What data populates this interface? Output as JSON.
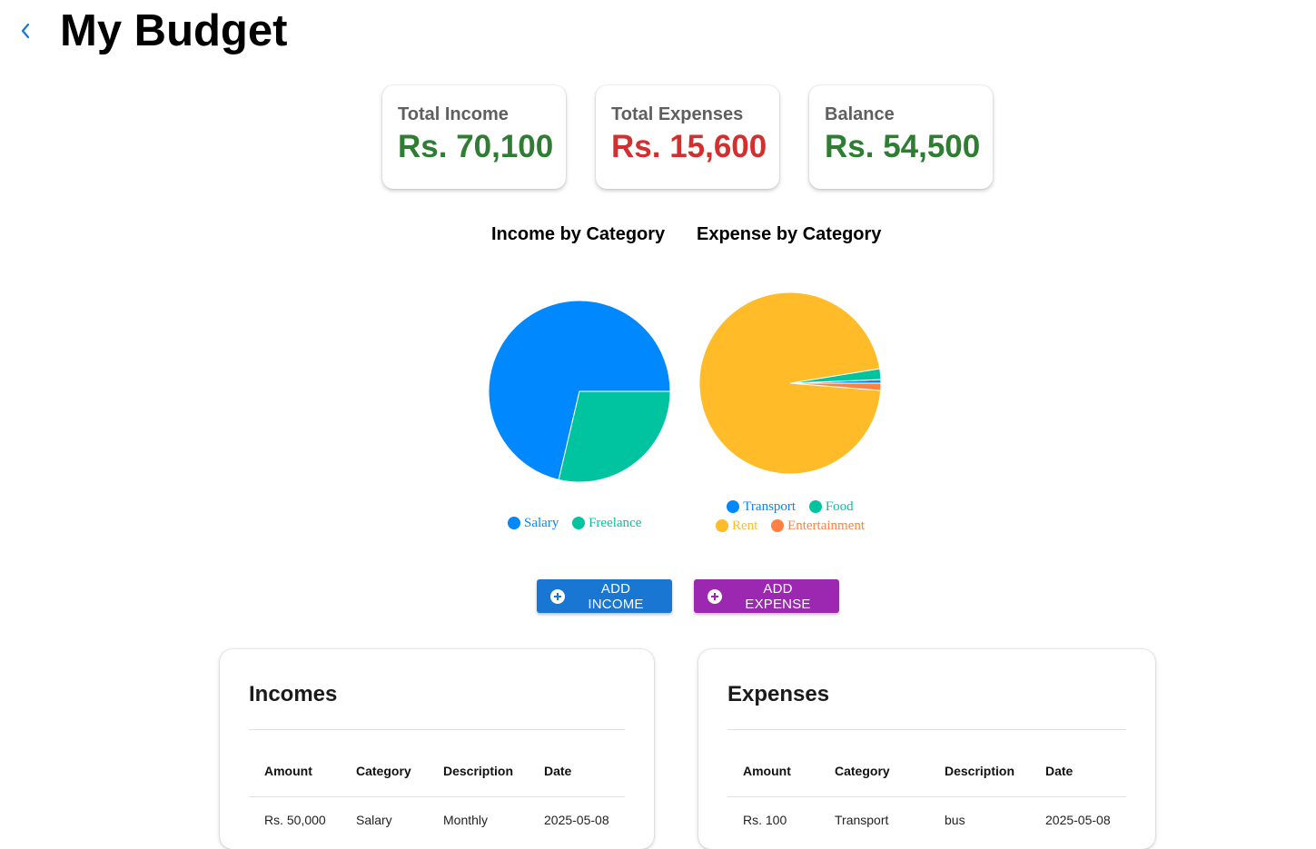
{
  "header": {
    "title": "My Budget",
    "back_icon": "chevron-left-icon"
  },
  "summary": [
    {
      "label": "Total Income",
      "value": "Rs. 70,100",
      "color": "#2e7d32"
    },
    {
      "label": "Total Expenses",
      "value": "Rs. 15,600",
      "color": "#d32f2f"
    },
    {
      "label": "Balance",
      "value": "Rs. 54,500",
      "color": "#2e7d32"
    }
  ],
  "chart_data": [
    {
      "type": "pie",
      "title": "Income by Category",
      "series": [
        {
          "name": "Salary",
          "value": 50000,
          "color": "#0088FE"
        },
        {
          "name": "Freelance",
          "value": 20100,
          "color": "#00C49F"
        }
      ]
    },
    {
      "type": "pie",
      "title": "Expense by Category",
      "series": [
        {
          "name": "Transport",
          "value": 100,
          "color": "#0088FE"
        },
        {
          "name": "Food",
          "value": 300,
          "color": "#00C49F"
        },
        {
          "name": "Rent",
          "value": 15000,
          "color": "#FFBB28"
        },
        {
          "name": "Entertainment",
          "value": 200,
          "color": "#FF8042"
        }
      ]
    }
  ],
  "actions": {
    "add_income": {
      "label": "ADD INCOME",
      "color": "#1976d2",
      "icon": "add-circle-icon"
    },
    "add_expense": {
      "label": "ADD EXPENSE",
      "color": "#9c27b0",
      "icon": "add-circle-icon"
    }
  },
  "incomes": {
    "title": "Incomes",
    "columns": [
      "Amount",
      "Category",
      "Description",
      "Date"
    ],
    "rows": [
      [
        "Rs. 50,000",
        "Salary",
        "Monthly",
        "2025-05-08"
      ]
    ]
  },
  "expenses": {
    "title": "Expenses",
    "columns": [
      "Amount",
      "Category",
      "Description",
      "Date"
    ],
    "rows": [
      [
        "Rs. 100",
        "Transport",
        "bus",
        "2025-05-08"
      ]
    ]
  }
}
